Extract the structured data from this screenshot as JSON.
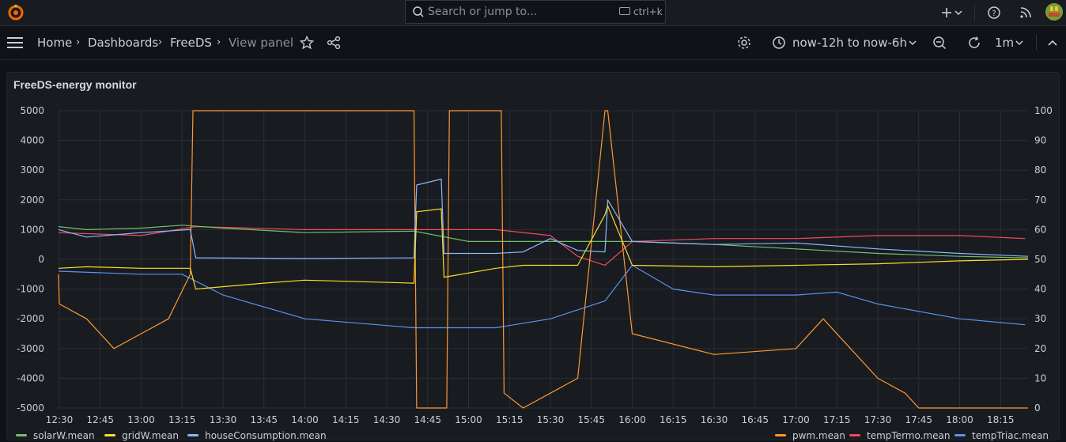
{
  "topbar": {
    "logo_icon": "grafana-logo-icon",
    "search_placeholder": "Search or jump to...",
    "search_shortcut": "ctrl+k"
  },
  "breadcrumb": {
    "home": "Home",
    "dashboards": "Dashboards",
    "dashboard": "FreeDS",
    "current": "View panel"
  },
  "toolbar": {
    "time_range": "now-12h to now-6h",
    "refresh_interval": "1m"
  },
  "panel": {
    "title": "FreeDS-energy monitor"
  },
  "colors": {
    "solar": "#73bf69",
    "grid": "#fade2a",
    "house": "#8ab8ff",
    "pwm": "#ff9830",
    "tempTermo": "#f2495c",
    "tempTriac": "#5794f2"
  },
  "chart_data": {
    "type": "line",
    "x_ticks": [
      "12:30",
      "12:45",
      "13:00",
      "13:15",
      "13:30",
      "13:45",
      "14:00",
      "14:15",
      "14:30",
      "14:45",
      "15:00",
      "15:15",
      "15:30",
      "15:45",
      "16:00",
      "16:15",
      "16:30",
      "16:45",
      "17:00",
      "17:15",
      "17:30",
      "17:45",
      "18:00",
      "18:15"
    ],
    "y_left": {
      "min": -5000,
      "max": 5000,
      "ticks": [
        5000,
        4000,
        3000,
        2000,
        1000,
        0,
        -1000,
        -2000,
        -3000,
        -4000,
        -5000
      ]
    },
    "y_right": {
      "min": 0,
      "max": 100,
      "ticks": [
        100,
        90,
        80,
        70,
        60,
        50,
        40,
        30,
        20,
        10,
        0
      ]
    },
    "grid": true,
    "legend_left": [
      "solarW.mean",
      "gridW.mean",
      "houseConsumption.mean"
    ],
    "legend_right": [
      "pwm.mean",
      "tempTermo.mean",
      "tempTriac.mean"
    ],
    "series": [
      {
        "name": "solarW.mean",
        "axis": "left",
        "x": [
          "12:24",
          "12:40",
          "13:00",
          "13:15",
          "13:30",
          "14:00",
          "14:40",
          "15:00",
          "15:30",
          "16:00",
          "16:30",
          "17:00",
          "17:30",
          "18:00",
          "18:30"
        ],
        "values": [
          1100,
          1000,
          1050,
          1150,
          1050,
          900,
          950,
          600,
          600,
          600,
          500,
          350,
          200,
          100,
          50
        ]
      },
      {
        "name": "gridW.mean",
        "axis": "left",
        "x": [
          "12:24",
          "12:40",
          "13:00",
          "13:18",
          "13:20",
          "13:45",
          "14:00",
          "14:40",
          "14:41",
          "14:50",
          "14:51",
          "15:10",
          "15:20",
          "15:40",
          "15:50",
          "15:51",
          "16:00",
          "16:30",
          "17:00",
          "17:30",
          "18:00",
          "18:30"
        ],
        "values": [
          -300,
          -250,
          -300,
          -300,
          -1000,
          -800,
          -700,
          -800,
          1600,
          1700,
          -600,
          -300,
          -200,
          -200,
          1500,
          1800,
          -200,
          -250,
          -200,
          -150,
          -50,
          0
        ]
      },
      {
        "name": "houseConsumption.mean",
        "axis": "left",
        "x": [
          "12:24",
          "12:40",
          "13:00",
          "13:18",
          "13:20",
          "14:00",
          "14:40",
          "14:41",
          "14:50",
          "14:51",
          "15:10",
          "15:20",
          "15:30",
          "15:40",
          "15:50",
          "15:51",
          "16:00",
          "16:30",
          "17:00",
          "17:30",
          "18:00",
          "18:30"
        ],
        "values": [
          1000,
          750,
          900,
          1000,
          50,
          30,
          50,
          2500,
          2700,
          200,
          200,
          250,
          700,
          300,
          250,
          2000,
          600,
          500,
          550,
          350,
          200,
          100
        ]
      },
      {
        "name": "pwm.mean",
        "axis": "right",
        "x": [
          "12:24",
          "12:30",
          "12:40",
          "12:50",
          "13:00",
          "13:10",
          "13:18",
          "13:19",
          "14:40",
          "14:41",
          "14:52",
          "14:53",
          "15:12",
          "15:13",
          "15:20",
          "15:30",
          "15:40",
          "15:50",
          "15:51",
          "16:00",
          "16:30",
          "17:00",
          "17:10",
          "17:20",
          "17:30",
          "17:40",
          "17:45",
          "18:30"
        ],
        "values": [
          45,
          35,
          30,
          20,
          25,
          30,
          45,
          100,
          100,
          0,
          0,
          100,
          100,
          5,
          0,
          5,
          10,
          100,
          100,
          25,
          18,
          20,
          30,
          20,
          10,
          5,
          0,
          0
        ]
      },
      {
        "name": "tempTermo.mean",
        "axis": "right",
        "x": [
          "12:24",
          "13:00",
          "13:20",
          "14:00",
          "14:40",
          "15:10",
          "15:30",
          "15:40",
          "15:50",
          "16:00",
          "16:30",
          "17:00",
          "17:30",
          "18:00",
          "18:24"
        ],
        "values": [
          59,
          58,
          61,
          60,
          60,
          60,
          58,
          51,
          48,
          56,
          57,
          57,
          58,
          58,
          57
        ]
      },
      {
        "name": "tempTriac.mean",
        "axis": "right",
        "x": [
          "12:24",
          "13:00",
          "13:15",
          "13:30",
          "14:00",
          "14:40",
          "15:10",
          "15:30",
          "15:50",
          "16:00",
          "16:15",
          "16:30",
          "17:00",
          "17:15",
          "17:30",
          "18:00",
          "18:24"
        ],
        "values": [
          46,
          45,
          45,
          38,
          30,
          27,
          27,
          30,
          36,
          48,
          40,
          38,
          38,
          39,
          35,
          30,
          28
        ]
      }
    ]
  }
}
